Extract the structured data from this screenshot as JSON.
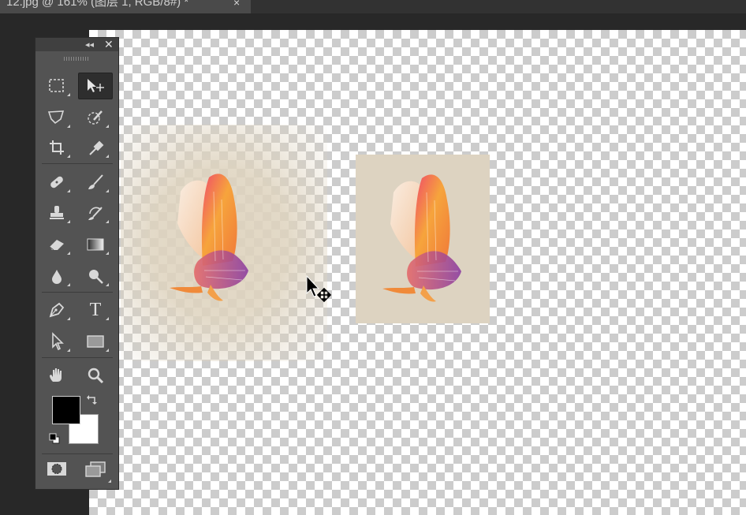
{
  "document": {
    "tab_title": "12.jpg @ 161% (图层 1, RGB/8#) *",
    "close_glyph": "×"
  },
  "tools_panel": {
    "collapse_glyph": "◂◂",
    "close_glyph": "✕",
    "items": [
      {
        "name": "rectangular-marquee-tool",
        "icon": "marquee-icon"
      },
      {
        "name": "move-tool",
        "icon": "move-icon",
        "active": true
      },
      {
        "name": "polygonal-lasso-tool",
        "icon": "lasso-icon"
      },
      {
        "name": "quick-selection-tool",
        "icon": "quick-selection-icon"
      },
      {
        "name": "crop-tool",
        "icon": "crop-icon"
      },
      {
        "name": "eyedropper-tool",
        "icon": "eyedropper-icon"
      },
      {
        "name": "spot-healing-brush-tool",
        "icon": "bandage-icon"
      },
      {
        "name": "brush-tool",
        "icon": "brush-icon"
      },
      {
        "name": "clone-stamp-tool",
        "icon": "stamp-icon"
      },
      {
        "name": "history-brush-tool",
        "icon": "history-brush-icon"
      },
      {
        "name": "eraser-tool",
        "icon": "eraser-icon"
      },
      {
        "name": "gradient-tool",
        "icon": "gradient-icon"
      },
      {
        "name": "blur-tool",
        "icon": "drop-icon"
      },
      {
        "name": "dodge-tool",
        "icon": "dodge-icon"
      },
      {
        "name": "pen-tool",
        "icon": "pen-icon"
      },
      {
        "name": "type-tool",
        "icon": "type-icon",
        "label": "T"
      },
      {
        "name": "path-selection-tool",
        "icon": "arrow-icon"
      },
      {
        "name": "rectangle-tool",
        "icon": "rectangle-icon"
      },
      {
        "name": "hand-tool",
        "icon": "hand-icon"
      },
      {
        "name": "zoom-tool",
        "icon": "zoom-icon"
      }
    ],
    "foreground_color": "#000000",
    "background_color": "#ffffff"
  },
  "canvas": {
    "background": "transparent-checkerboard",
    "wing_colors": [
      "#f28a3a",
      "#f6b23e",
      "#e25a8a",
      "#9b4fa8",
      "#f6e6d8"
    ]
  }
}
